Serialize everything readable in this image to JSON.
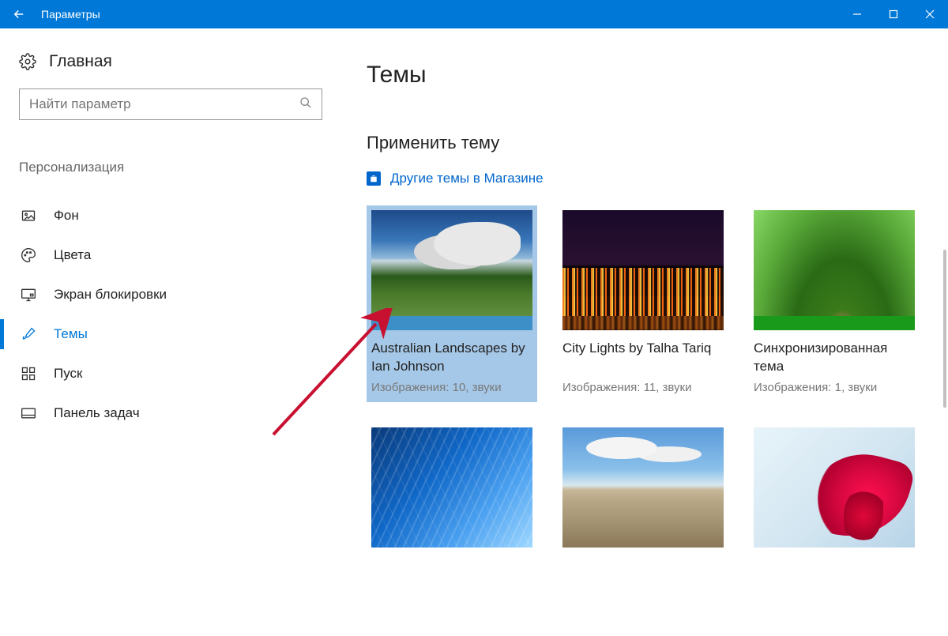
{
  "window": {
    "title": "Параметры"
  },
  "sidebar": {
    "home": "Главная",
    "search_placeholder": "Найти параметр",
    "category": "Персонализация",
    "items": [
      {
        "label": "Фон",
        "icon": "picture-icon"
      },
      {
        "label": "Цвета",
        "icon": "palette-icon"
      },
      {
        "label": "Экран блокировки",
        "icon": "monitor-icon"
      },
      {
        "label": "Темы",
        "icon": "brush-icon",
        "active": true
      },
      {
        "label": "Пуск",
        "icon": "grid-icon"
      },
      {
        "label": "Панель задач",
        "icon": "taskbar-icon"
      }
    ]
  },
  "main": {
    "page_title": "Темы",
    "section_title": "Применить тему",
    "store_link": "Другие темы в Магазине",
    "themes": [
      {
        "name": "Australian Landscapes by Ian Johnson",
        "meta": "Изображения: 10, звуки",
        "selected": true
      },
      {
        "name": "City Lights by Talha Tariq",
        "meta": "Изображения: 11, звуки"
      },
      {
        "name": "Синхронизированная тема",
        "meta": "Изображения: 1, звуки"
      },
      {
        "name": "",
        "meta": ""
      },
      {
        "name": "",
        "meta": ""
      },
      {
        "name": "",
        "meta": ""
      }
    ]
  }
}
